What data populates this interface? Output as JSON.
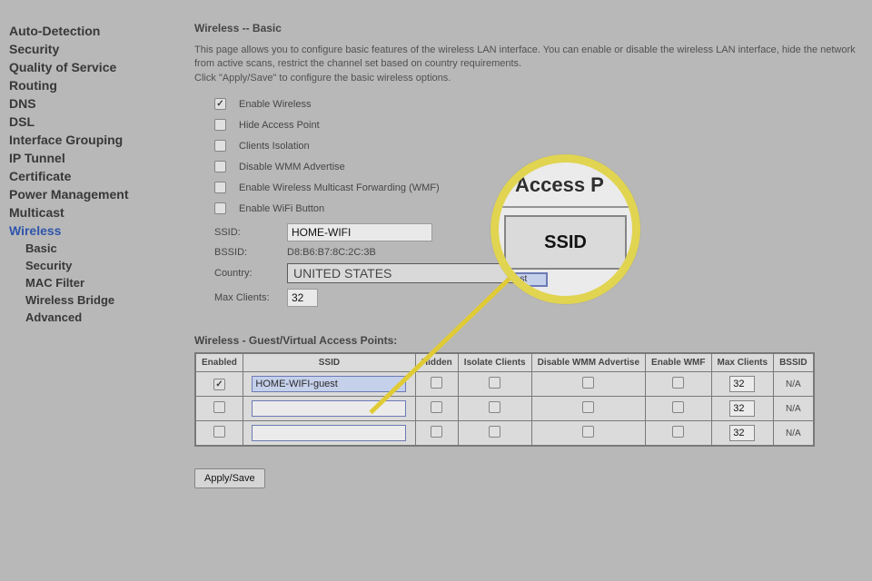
{
  "sidebar": {
    "items": [
      {
        "label": "Auto-Detection",
        "active": false,
        "sub": false
      },
      {
        "label": "Security",
        "active": false,
        "sub": false
      },
      {
        "label": "Quality of Service",
        "active": false,
        "sub": false
      },
      {
        "label": "Routing",
        "active": false,
        "sub": false
      },
      {
        "label": "DNS",
        "active": false,
        "sub": false
      },
      {
        "label": "DSL",
        "active": false,
        "sub": false
      },
      {
        "label": "Interface Grouping",
        "active": false,
        "sub": false
      },
      {
        "label": "IP Tunnel",
        "active": false,
        "sub": false
      },
      {
        "label": "Certificate",
        "active": false,
        "sub": false
      },
      {
        "label": "Power Management",
        "active": false,
        "sub": false
      },
      {
        "label": "Multicast",
        "active": false,
        "sub": false
      },
      {
        "label": "Wireless",
        "active": true,
        "sub": false
      },
      {
        "label": "Basic",
        "active": false,
        "sub": true
      },
      {
        "label": "Security",
        "active": false,
        "sub": true
      },
      {
        "label": "MAC Filter",
        "active": false,
        "sub": true
      },
      {
        "label": "Wireless Bridge",
        "active": false,
        "sub": true
      },
      {
        "label": "Advanced",
        "active": false,
        "sub": true
      }
    ]
  },
  "page": {
    "title": "Wireless -- Basic",
    "desc1": "This page allows you to configure basic features of the wireless LAN interface. You can enable or disable the wireless LAN interface, hide the network from active scans, restrict the channel set based on country requirements.",
    "desc2": "Click \"Apply/Save\" to configure the basic wireless options."
  },
  "checks": {
    "enable_wireless": {
      "label": "Enable Wireless",
      "checked": true
    },
    "hide_ap": {
      "label": "Hide Access Point",
      "checked": false
    },
    "clients_isolation": {
      "label": "Clients Isolation",
      "checked": false
    },
    "disable_wmm": {
      "label": "Disable WMM Advertise",
      "checked": false
    },
    "enable_wmf": {
      "label": "Enable Wireless Multicast Forwarding (WMF)",
      "checked": false
    },
    "enable_wifi_btn": {
      "label": "Enable WiFi Button",
      "checked": false
    }
  },
  "fields": {
    "ssid_label": "SSID:",
    "ssid_value": "HOME-WIFI",
    "bssid_label": "BSSID:",
    "bssid_value": "D8:B6:B7:8C:2C:3B",
    "country_label": "Country:",
    "country_value": "UNITED STATES",
    "max_clients_label": "Max Clients:",
    "max_clients_value": "32"
  },
  "guest": {
    "heading": "Wireless - Guest/Virtual Access Points:",
    "headers": [
      "Enabled",
      "SSID",
      "Hidden",
      "Isolate Clients",
      "Disable WMM Advertise",
      "Enable WMF",
      "Max Clients",
      "BSSID"
    ],
    "rows": [
      {
        "enabled": true,
        "ssid": "HOME-WIFI-guest",
        "ssid_selected": true,
        "hidden": false,
        "isolate": false,
        "dwmm": false,
        "ewmf": false,
        "max": "32",
        "bssid": "N/A"
      },
      {
        "enabled": false,
        "ssid": "",
        "ssid_selected": false,
        "hidden": false,
        "isolate": false,
        "dwmm": false,
        "ewmf": false,
        "max": "32",
        "bssid": "N/A"
      },
      {
        "enabled": false,
        "ssid": "",
        "ssid_selected": false,
        "hidden": false,
        "isolate": false,
        "dwmm": false,
        "ewmf": false,
        "max": "32",
        "bssid": "N/A"
      }
    ]
  },
  "apply_label": "Apply/Save",
  "magnifier": {
    "ap_text": "Access P",
    "ssid_text": "SSID",
    "frag": "est"
  }
}
